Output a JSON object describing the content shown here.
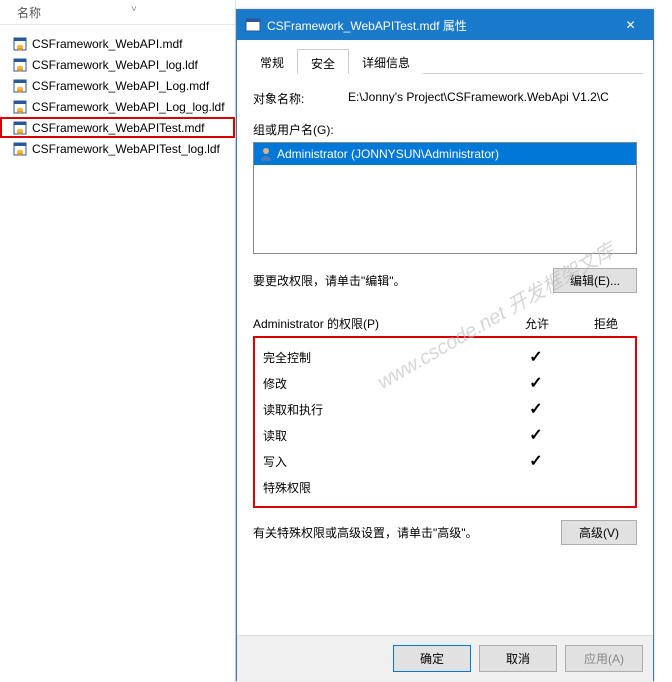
{
  "explorer": {
    "column_name": "名称",
    "files": [
      {
        "name": "CSFramework_WebAPI.mdf",
        "highlighted": false,
        "type": "mdf"
      },
      {
        "name": "CSFramework_WebAPI_log.ldf",
        "highlighted": false,
        "type": "ldf"
      },
      {
        "name": "CSFramework_WebAPI_Log.mdf",
        "highlighted": false,
        "type": "mdf"
      },
      {
        "name": "CSFramework_WebAPI_Log_log.ldf",
        "highlighted": false,
        "type": "ldf"
      },
      {
        "name": "CSFramework_WebAPITest.mdf",
        "highlighted": true,
        "type": "mdf"
      },
      {
        "name": "CSFramework_WebAPITest_log.ldf",
        "highlighted": false,
        "type": "ldf"
      }
    ]
  },
  "dialog": {
    "title": "CSFramework_WebAPITest.mdf 属性",
    "tabs": {
      "general": "常规",
      "security": "安全",
      "details": "详细信息"
    },
    "object_name_label": "对象名称:",
    "object_name_value": "E:\\Jonny's Project\\CSFramework.WebApi V1.2\\C",
    "group_label": "组或用户名(G):",
    "user": "Administrator (JONNYSUN\\Administrator)",
    "edit_hint": "要更改权限，请单击\"编辑\"。",
    "edit_button": "编辑(E)...",
    "perm_header_label": "Administrator 的权限(P)",
    "perm_header_allow": "允许",
    "perm_header_deny": "拒绝",
    "permissions": [
      {
        "name": "完全控制",
        "allow": true,
        "deny": false
      },
      {
        "name": "修改",
        "allow": true,
        "deny": false
      },
      {
        "name": "读取和执行",
        "allow": true,
        "deny": false
      },
      {
        "name": "读取",
        "allow": true,
        "deny": false
      },
      {
        "name": "写入",
        "allow": true,
        "deny": false
      },
      {
        "name": "特殊权限",
        "allow": false,
        "deny": false
      }
    ],
    "advanced_hint": "有关特殊权限或高级设置，请单击\"高级\"。",
    "advanced_button": "高级(V)",
    "footer": {
      "ok": "确定",
      "cancel": "取消",
      "apply": "应用(A)"
    }
  },
  "watermark": "www.cscode.net 开发框架文库"
}
